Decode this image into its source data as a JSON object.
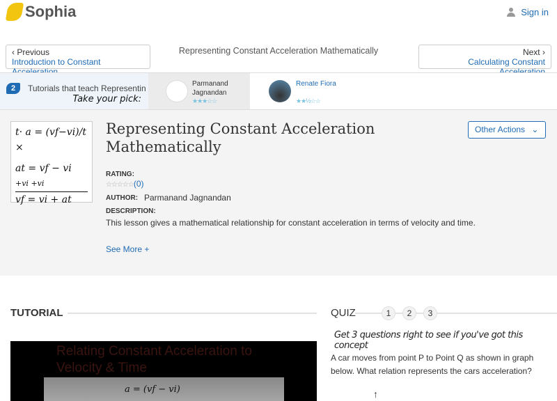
{
  "header": {
    "brand": "Sophia",
    "signin": "Sign in"
  },
  "nav": {
    "previous_label": "Previous",
    "previous_link": "Introduction to Constant Acceleration",
    "current": "Representing Constant Acceleration Mathematically",
    "next_label": "Next",
    "next_link": "Calculating Constant Acceleration"
  },
  "tutorials": {
    "count": "2",
    "text": "Tutorials that teach Representing Constant Acceleration Mathematically",
    "pick": "Take your pick:",
    "items": [
      {
        "author": "Parmanand Jagnandan",
        "rating": 3
      },
      {
        "author": "Renate Fiora",
        "rating": 2.5
      }
    ]
  },
  "lesson": {
    "title": "Representing Constant Acceleration Mathematically",
    "rating_label": "RATING:",
    "rating_count": "(0)",
    "author_label": "AUTHOR:",
    "author": "Parmanand Jagnandan",
    "description_label": "DESCRIPTION:",
    "description": "This lesson gives a mathematical relationship for constant acceleration in terms of velocity and time.",
    "see_more": "See More +",
    "other_actions": "Other Actions",
    "thumb_lines": [
      "t· a = (vf−vi)/t ×",
      "at = vf − vi",
      "+vi    +vi",
      "vf = vi + at"
    ]
  },
  "tutorial": {
    "heading": "TUTORIAL",
    "video_title": "Relating Constant Acceleration to Velocity & Time",
    "video_formula": "a = (vf − vi)"
  },
  "quiz": {
    "heading": "QUIZ",
    "steps": [
      "1",
      "2",
      "3"
    ],
    "prompt": "Get 3 questions right to see if you've got this concept",
    "question": "A car moves from point P to Point Q as shown in graph below. What relation represents the cars acceleration?"
  }
}
